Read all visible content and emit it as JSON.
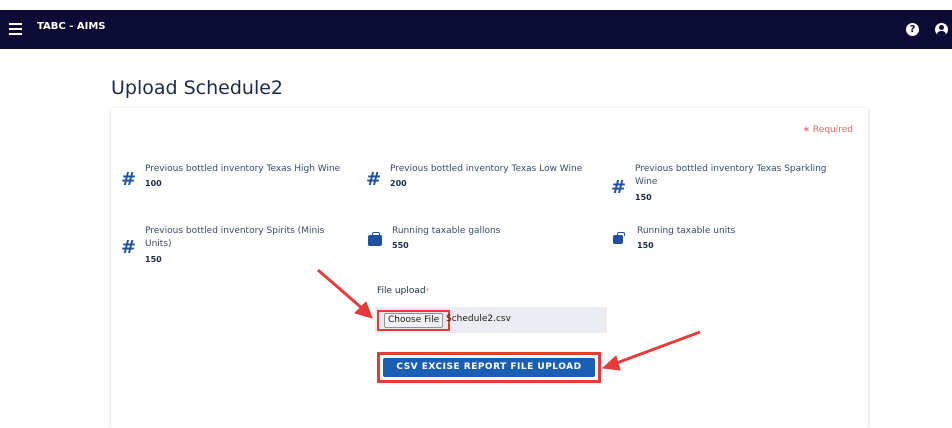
{
  "header": {
    "title": "TABC - AIMS",
    "help_glyph": "?"
  },
  "page": {
    "title": "Upload Schedule2"
  },
  "form": {
    "required_note": "∗ Required",
    "fields": [
      {
        "label": "Previous bottled inventory Texas High Wine",
        "value": "100",
        "icon": "hash-icon"
      },
      {
        "label": "Previous bottled inventory Texas Low Wine",
        "value": "200",
        "icon": "hash-icon"
      },
      {
        "label_line1": "Previous bottled inventory Texas Sparkling",
        "label_line2": "Wine",
        "value": "150",
        "icon": "hash-icon"
      },
      {
        "label_line1": "Previous bottled inventory Spirits (Minis",
        "label_line2": "Units)",
        "value": "150",
        "icon": "hash-icon"
      },
      {
        "label": "Running taxable gallons",
        "value": "550",
        "icon": "briefcase-icon"
      },
      {
        "label": "Running taxable units",
        "value": "150",
        "icon": "briefcase-icon"
      }
    ],
    "upload": {
      "label": "File upload",
      "required_mark": "*",
      "choose_button": "Choose File",
      "file_name": "Schedule2.csv",
      "submit_button": "CSV EXCISE REPORT FILE UPLOAD"
    }
  },
  "colors": {
    "header_bg": "#0b0b35",
    "accent": "#1a5fb4",
    "highlight": "#e53b3b",
    "required": "#e06a6a"
  }
}
